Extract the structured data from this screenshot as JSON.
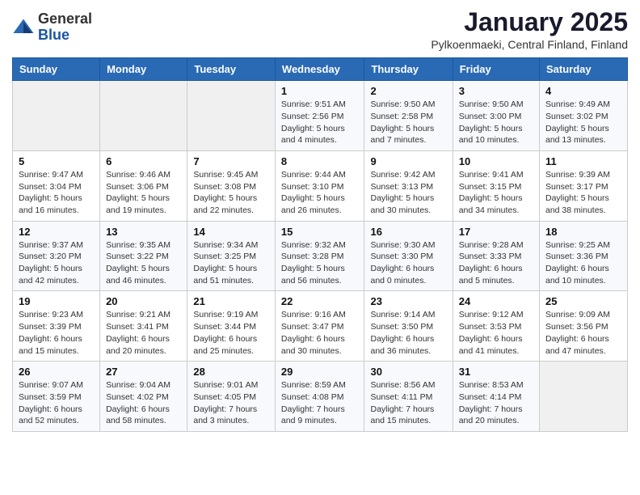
{
  "header": {
    "logo_general": "General",
    "logo_blue": "Blue",
    "title": "January 2025",
    "location": "Pylkoenmaeki, Central Finland, Finland"
  },
  "weekdays": [
    "Sunday",
    "Monday",
    "Tuesday",
    "Wednesday",
    "Thursday",
    "Friday",
    "Saturday"
  ],
  "weeks": [
    [
      {
        "day": "",
        "info": ""
      },
      {
        "day": "",
        "info": ""
      },
      {
        "day": "",
        "info": ""
      },
      {
        "day": "1",
        "info": "Sunrise: 9:51 AM\nSunset: 2:56 PM\nDaylight: 5 hours and 4 minutes."
      },
      {
        "day": "2",
        "info": "Sunrise: 9:50 AM\nSunset: 2:58 PM\nDaylight: 5 hours and 7 minutes."
      },
      {
        "day": "3",
        "info": "Sunrise: 9:50 AM\nSunset: 3:00 PM\nDaylight: 5 hours and 10 minutes."
      },
      {
        "day": "4",
        "info": "Sunrise: 9:49 AM\nSunset: 3:02 PM\nDaylight: 5 hours and 13 minutes."
      }
    ],
    [
      {
        "day": "5",
        "info": "Sunrise: 9:47 AM\nSunset: 3:04 PM\nDaylight: 5 hours and 16 minutes."
      },
      {
        "day": "6",
        "info": "Sunrise: 9:46 AM\nSunset: 3:06 PM\nDaylight: 5 hours and 19 minutes."
      },
      {
        "day": "7",
        "info": "Sunrise: 9:45 AM\nSunset: 3:08 PM\nDaylight: 5 hours and 22 minutes."
      },
      {
        "day": "8",
        "info": "Sunrise: 9:44 AM\nSunset: 3:10 PM\nDaylight: 5 hours and 26 minutes."
      },
      {
        "day": "9",
        "info": "Sunrise: 9:42 AM\nSunset: 3:13 PM\nDaylight: 5 hours and 30 minutes."
      },
      {
        "day": "10",
        "info": "Sunrise: 9:41 AM\nSunset: 3:15 PM\nDaylight: 5 hours and 34 minutes."
      },
      {
        "day": "11",
        "info": "Sunrise: 9:39 AM\nSunset: 3:17 PM\nDaylight: 5 hours and 38 minutes."
      }
    ],
    [
      {
        "day": "12",
        "info": "Sunrise: 9:37 AM\nSunset: 3:20 PM\nDaylight: 5 hours and 42 minutes."
      },
      {
        "day": "13",
        "info": "Sunrise: 9:35 AM\nSunset: 3:22 PM\nDaylight: 5 hours and 46 minutes."
      },
      {
        "day": "14",
        "info": "Sunrise: 9:34 AM\nSunset: 3:25 PM\nDaylight: 5 hours and 51 minutes."
      },
      {
        "day": "15",
        "info": "Sunrise: 9:32 AM\nSunset: 3:28 PM\nDaylight: 5 hours and 56 minutes."
      },
      {
        "day": "16",
        "info": "Sunrise: 9:30 AM\nSunset: 3:30 PM\nDaylight: 6 hours and 0 minutes."
      },
      {
        "day": "17",
        "info": "Sunrise: 9:28 AM\nSunset: 3:33 PM\nDaylight: 6 hours and 5 minutes."
      },
      {
        "day": "18",
        "info": "Sunrise: 9:25 AM\nSunset: 3:36 PM\nDaylight: 6 hours and 10 minutes."
      }
    ],
    [
      {
        "day": "19",
        "info": "Sunrise: 9:23 AM\nSunset: 3:39 PM\nDaylight: 6 hours and 15 minutes."
      },
      {
        "day": "20",
        "info": "Sunrise: 9:21 AM\nSunset: 3:41 PM\nDaylight: 6 hours and 20 minutes."
      },
      {
        "day": "21",
        "info": "Sunrise: 9:19 AM\nSunset: 3:44 PM\nDaylight: 6 hours and 25 minutes."
      },
      {
        "day": "22",
        "info": "Sunrise: 9:16 AM\nSunset: 3:47 PM\nDaylight: 6 hours and 30 minutes."
      },
      {
        "day": "23",
        "info": "Sunrise: 9:14 AM\nSunset: 3:50 PM\nDaylight: 6 hours and 36 minutes."
      },
      {
        "day": "24",
        "info": "Sunrise: 9:12 AM\nSunset: 3:53 PM\nDaylight: 6 hours and 41 minutes."
      },
      {
        "day": "25",
        "info": "Sunrise: 9:09 AM\nSunset: 3:56 PM\nDaylight: 6 hours and 47 minutes."
      }
    ],
    [
      {
        "day": "26",
        "info": "Sunrise: 9:07 AM\nSunset: 3:59 PM\nDaylight: 6 hours and 52 minutes."
      },
      {
        "day": "27",
        "info": "Sunrise: 9:04 AM\nSunset: 4:02 PM\nDaylight: 6 hours and 58 minutes."
      },
      {
        "day": "28",
        "info": "Sunrise: 9:01 AM\nSunset: 4:05 PM\nDaylight: 7 hours and 3 minutes."
      },
      {
        "day": "29",
        "info": "Sunrise: 8:59 AM\nSunset: 4:08 PM\nDaylight: 7 hours and 9 minutes."
      },
      {
        "day": "30",
        "info": "Sunrise: 8:56 AM\nSunset: 4:11 PM\nDaylight: 7 hours and 15 minutes."
      },
      {
        "day": "31",
        "info": "Sunrise: 8:53 AM\nSunset: 4:14 PM\nDaylight: 7 hours and 20 minutes."
      },
      {
        "day": "",
        "info": ""
      }
    ]
  ]
}
